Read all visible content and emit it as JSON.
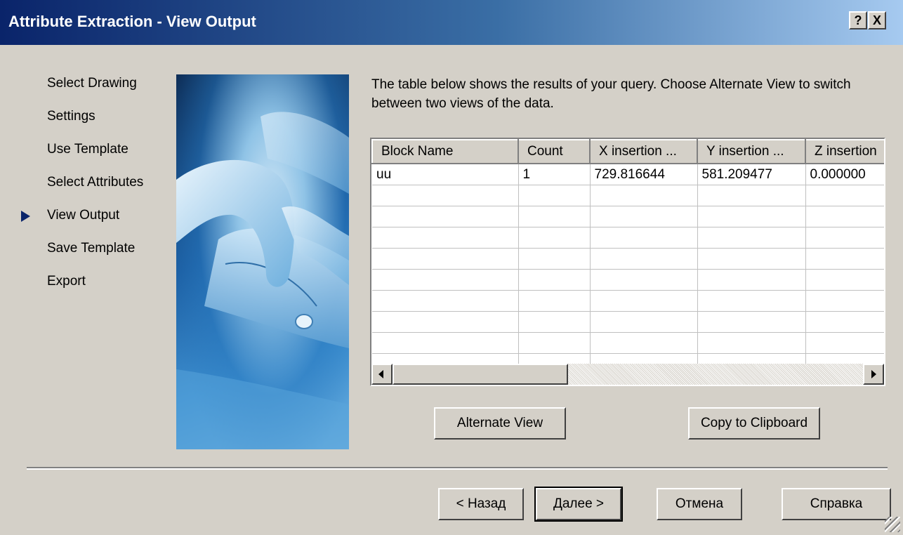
{
  "window": {
    "title": "Attribute Extraction - View Output",
    "help_button": "?",
    "close_button": "X"
  },
  "steps": [
    {
      "label": "Select Drawing"
    },
    {
      "label": "Settings"
    },
    {
      "label": "Use Template"
    },
    {
      "label": "Select Attributes"
    },
    {
      "label": "View Output",
      "current": true
    },
    {
      "label": "Save Template"
    },
    {
      "label": "Export"
    }
  ],
  "intro_text": "The table below shows the results of your query. Choose Alternate View to switch between two views of the data.",
  "table": {
    "columns": [
      "Block Name",
      "Count",
      "X insertion ...",
      "Y insertion ...",
      "Z insertion"
    ],
    "rows": [
      [
        "uu",
        "1",
        "729.816644",
        "581.209477",
        "0.000000"
      ]
    ]
  },
  "buttons": {
    "alternate_view": "Alternate View",
    "copy_to_clipboard": "Copy to Clipboard",
    "back": "< Назад",
    "next": "Далее >",
    "cancel": "Отмена",
    "help": "Справка"
  },
  "colors": {
    "titlebar_start": "#0a246a",
    "titlebar_end": "#a6caf0",
    "dialog_bg": "#d4d0c8",
    "current_step_arrow": "#0a246a"
  },
  "icons": {
    "current_step": "triangle-right-icon",
    "scroll_left": "scroll-left-arrow-icon",
    "scroll_right": "scroll-right-arrow-icon",
    "resize_grip": "resize-grip-icon"
  }
}
